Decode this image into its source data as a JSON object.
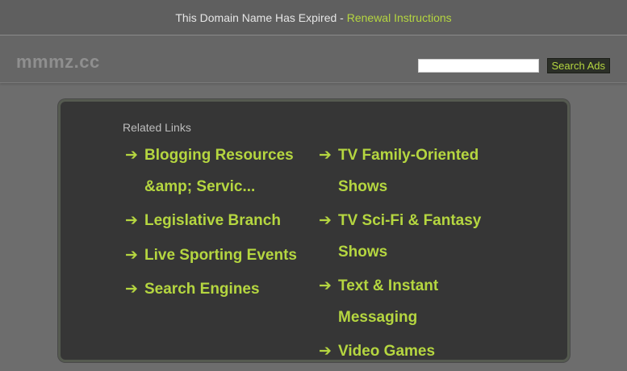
{
  "topbar": {
    "expired_text": "This Domain Name Has Expired - ",
    "renewal_link": "Renewal Instructions"
  },
  "header": {
    "logo": "mmmz.cc",
    "search_placeholder": "",
    "search_button": "Search Ads"
  },
  "related": {
    "title": "Related Links",
    "arrow": "➔",
    "left": [
      "Blogging Resources &amp; Servic...",
      "Legislative Branch",
      "Live Sporting Events",
      "Search Engines"
    ],
    "right": [
      "TV Family-Oriented Shows",
      "TV Sci-Fi & Fantasy Shows",
      "Text & Instant Messaging",
      "Video Games"
    ]
  },
  "colors": {
    "accent": "#b5d640",
    "panel": "#363636",
    "background": "#6d6d6d"
  }
}
